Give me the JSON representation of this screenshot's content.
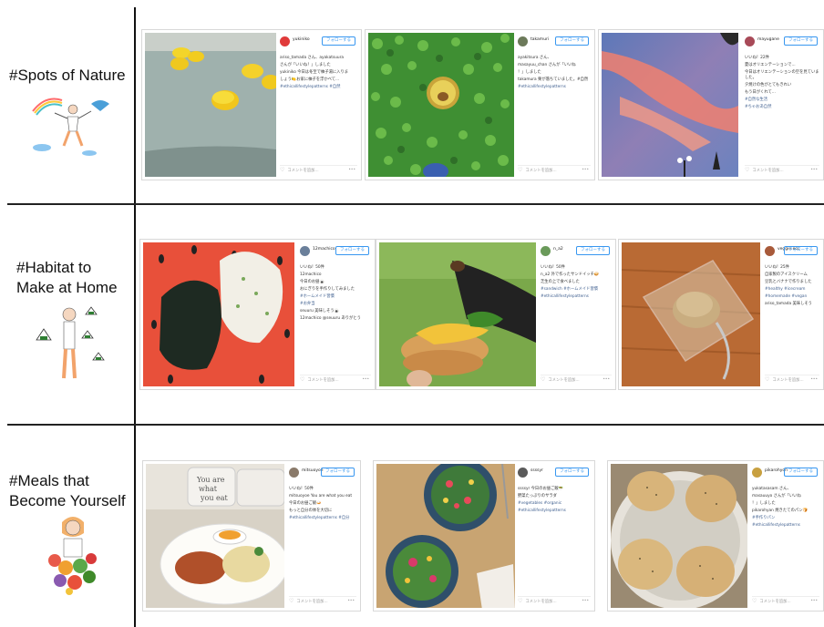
{
  "sections": [
    {
      "title_lines": [
        "#Spots of Nature"
      ],
      "posts": [
        {
          "user": "yukiniko",
          "follow": "フォローする",
          "lines": [
            "ariso_tamada さん、ayakatsuura",
            "さんが「いいね！」しました",
            "yukiniko 今日は冬至で柚子湯に入りま",
            "しょう🍋お家に柚子を浮かべて...",
            "#ethicallifestylepatterns #自然"
          ],
          "comment": "コメントを追加...",
          "more": "•••"
        },
        {
          "user": "takamuri",
          "follow": "フォローする",
          "lines": [
            "ayakitsura さん、",
            "masayuu_chan さんが「いいね",
            "！」しました",
            "takamura 栗が落ちていました。#自然",
            "#ethicallifestylepatterns"
          ],
          "comment": "コメントを追加...",
          "more": "•••"
        },
        {
          "user": "mayugane",
          "follow": "フォローする",
          "lines": [
            "いいね！22件",
            "夏はオリエンテーションで...",
            "今日はオリエンテーションの空を見ていました。",
            "夕焼けの色がとてもきれい",
            "もう日がくれて...",
            "#自然な生活",
            "#ちゃおあ自然"
          ],
          "comment": "コメントを追加...",
          "more": "•••"
        }
      ]
    },
    {
      "title_lines": [
        "#Habitat to",
        "Make at Home"
      ],
      "posts": [
        {
          "user": "12machico",
          "follow": "フォローする",
          "lines": [
            "いいね！50件",
            "12machico",
            "今日のお昼🍙",
            "おにぎりを手作りしてみました",
            "#ホームメイド習慣",
            "#お弁当",
            "seuuru 美味しそう🍙",
            "12machico @seuuru ありがとう"
          ],
          "comment": "コメントを追加...",
          "more": "•••"
        },
        {
          "user": "n_a2",
          "follow": "フォローする",
          "lines": [
            "いいね！50件",
            "n_a2 外で作ったサンドイッチ🥪",
            "芝生の上で食べました",
            "#sandwich #ホームメイド習慣",
            "#ethicallifestylepatterns"
          ],
          "comment": "コメントを追加...",
          "more": "•••"
        },
        {
          "user": "veggie.ecc",
          "follow": "フォローする",
          "lines": [
            "いいね！25件",
            "自家製のアイスクリーム",
            "豆乳とバナナで作りました",
            "#healthy #icecream",
            "#homemade #vegan",
            "ariso_tamada 美味しそう"
          ],
          "comment": "コメントを追加...",
          "more": "•••"
        }
      ]
    },
    {
      "title_lines": [
        "#Meals that",
        "Become Yourself"
      ],
      "posts": [
        {
          "user": "mitsuoyoe",
          "follow": "フォローする",
          "lines": [
            "いいね！50件",
            "mitsuoyoe You are what you eat",
            "今日のお昼ご飯🍛",
            "もっと自分の体を大切に",
            "#ethicallifestylepatterns #自分"
          ],
          "comment": "コメントを追加...",
          "more": "•••"
        },
        {
          "user": "ssssyr",
          "follow": "フォローする",
          "lines": [
            "ssssyr 今日のお昼ご飯🥗",
            "野菜たっぷりのサラダ",
            "#vegetables #organic",
            "#ethicallifestylepatterns"
          ],
          "comment": "コメントを追加...",
          "more": "•••"
        },
        {
          "user": "pikarohyon",
          "follow": "フォローする",
          "lines": [
            "yukatasasam さん、",
            "masauuyo さんが「いいね",
            "！」しました",
            "pikarohyan 焼きたてのパン🍞",
            "#手作りパン",
            "#ethicallifestylepatterns"
          ],
          "comment": "コメントを追加...",
          "more": "•••"
        }
      ]
    }
  ],
  "colors": {
    "follow_blue": "#3897f0",
    "divider": "#111111"
  }
}
